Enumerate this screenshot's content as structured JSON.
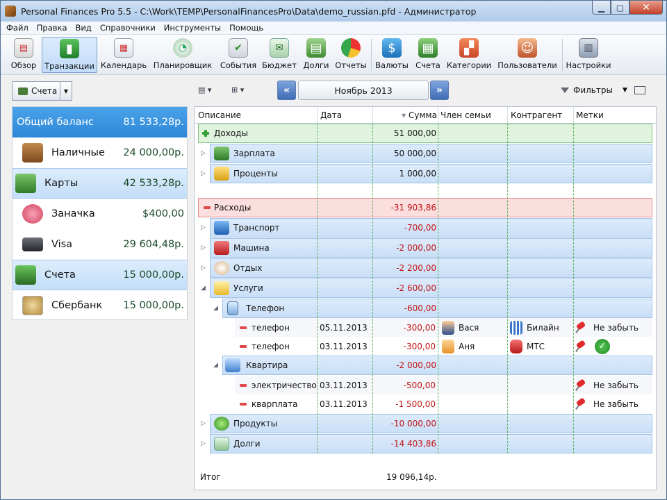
{
  "window": {
    "title": "Personal Finances Pro 5.5 - C:\\Work\\TEMP\\PersonalFinancesPro\\Data\\demo_russian.pfd - Администратор"
  },
  "menu": [
    "Файл",
    "Правка",
    "Вид",
    "Справочники",
    "Инструменты",
    "Помощь"
  ],
  "toolbar": [
    {
      "label": "Обзор",
      "icon": "overview-icon"
    },
    {
      "label": "Транзакции",
      "icon": "transactions-icon"
    },
    {
      "label": "Календарь",
      "icon": "calendar-icon"
    },
    {
      "label": "Планировщик",
      "icon": "scheduler-icon"
    },
    {
      "label": "События",
      "icon": "events-icon"
    },
    {
      "label": "Бюджет",
      "icon": "budget-icon"
    },
    {
      "label": "Долги",
      "icon": "debts-icon"
    },
    {
      "label": "Отчеты",
      "icon": "reports-icon"
    },
    {
      "label": "Валюты",
      "icon": "currencies-icon"
    },
    {
      "label": "Счета",
      "icon": "accounts-icon"
    },
    {
      "label": "Категории",
      "icon": "categories-icon"
    },
    {
      "label": "Пользователи",
      "icon": "users-icon"
    },
    {
      "label": "Настройки",
      "icon": "settings-icon"
    }
  ],
  "subbar": {
    "accounts_label": "Счета",
    "period": "Ноябрь 2013",
    "filters_label": "Фильтры"
  },
  "accounts": [
    {
      "name": "Общий баланс",
      "value": "81 533,28р."
    },
    {
      "name": "Наличные",
      "value": "24 000,00р."
    },
    {
      "name": "Карты",
      "value": "42 533,28р."
    },
    {
      "name": "Заначка",
      "value": "$400,00"
    },
    {
      "name": "Visa",
      "value": "29 604,48р."
    },
    {
      "name": "Счета",
      "value": "15 000,00р."
    },
    {
      "name": "Сбербанк",
      "value": "15 000,00р."
    }
  ],
  "columns": [
    "Описание",
    "Дата",
    "Сумма",
    "Член семьи",
    "Контрагент",
    "Метки"
  ],
  "rows": {
    "income": {
      "label": "Доходы",
      "amount": "51 000,00"
    },
    "salary": {
      "label": "Зарплата",
      "amount": "50 000,00"
    },
    "interest": {
      "label": "Проценты",
      "amount": "1 000,00"
    },
    "expenses": {
      "label": "Расходы",
      "amount": "-31 903,86"
    },
    "transport": {
      "label": "Транспорт",
      "amount": "-700,00"
    },
    "car": {
      "label": "Машина",
      "amount": "-2 000,00"
    },
    "leisure": {
      "label": "Отдых",
      "amount": "-2 200,00"
    },
    "services": {
      "label": "Услуги",
      "amount": "-2 600,00"
    },
    "phone": {
      "label": "Телефон",
      "amount": "-600,00"
    },
    "t1": {
      "label": "телефон",
      "date": "05.11.2013",
      "amount": "-300,00",
      "member": "Вася",
      "contra": "Билайн",
      "tag": "Не забыть"
    },
    "t2": {
      "label": "телефон",
      "date": "03.11.2013",
      "amount": "-300,00",
      "member": "Аня",
      "contra": "МТС"
    },
    "apartment": {
      "label": "Квартира",
      "amount": "-2 000,00"
    },
    "t3": {
      "label": "электричество",
      "date": "03.11.2013",
      "amount": "-500,00",
      "tag": "Не забыть"
    },
    "t4": {
      "label": "кварплата",
      "date": "03.11.2013",
      "amount": "-1 500,00",
      "tag": "Не забыть"
    },
    "food": {
      "label": "Продукты",
      "amount": "-10 000,00"
    },
    "debts": {
      "label": "Долги",
      "amount": "-14 403,86"
    }
  },
  "total": {
    "label": "Итог",
    "amount": "19 096,14р."
  },
  "colors": {
    "income_bg": "#dff3df",
    "expense_bg": "#fbdede",
    "category_bg": "#c9dff7",
    "negative": "#c21414",
    "selection": "#2e87d8"
  }
}
